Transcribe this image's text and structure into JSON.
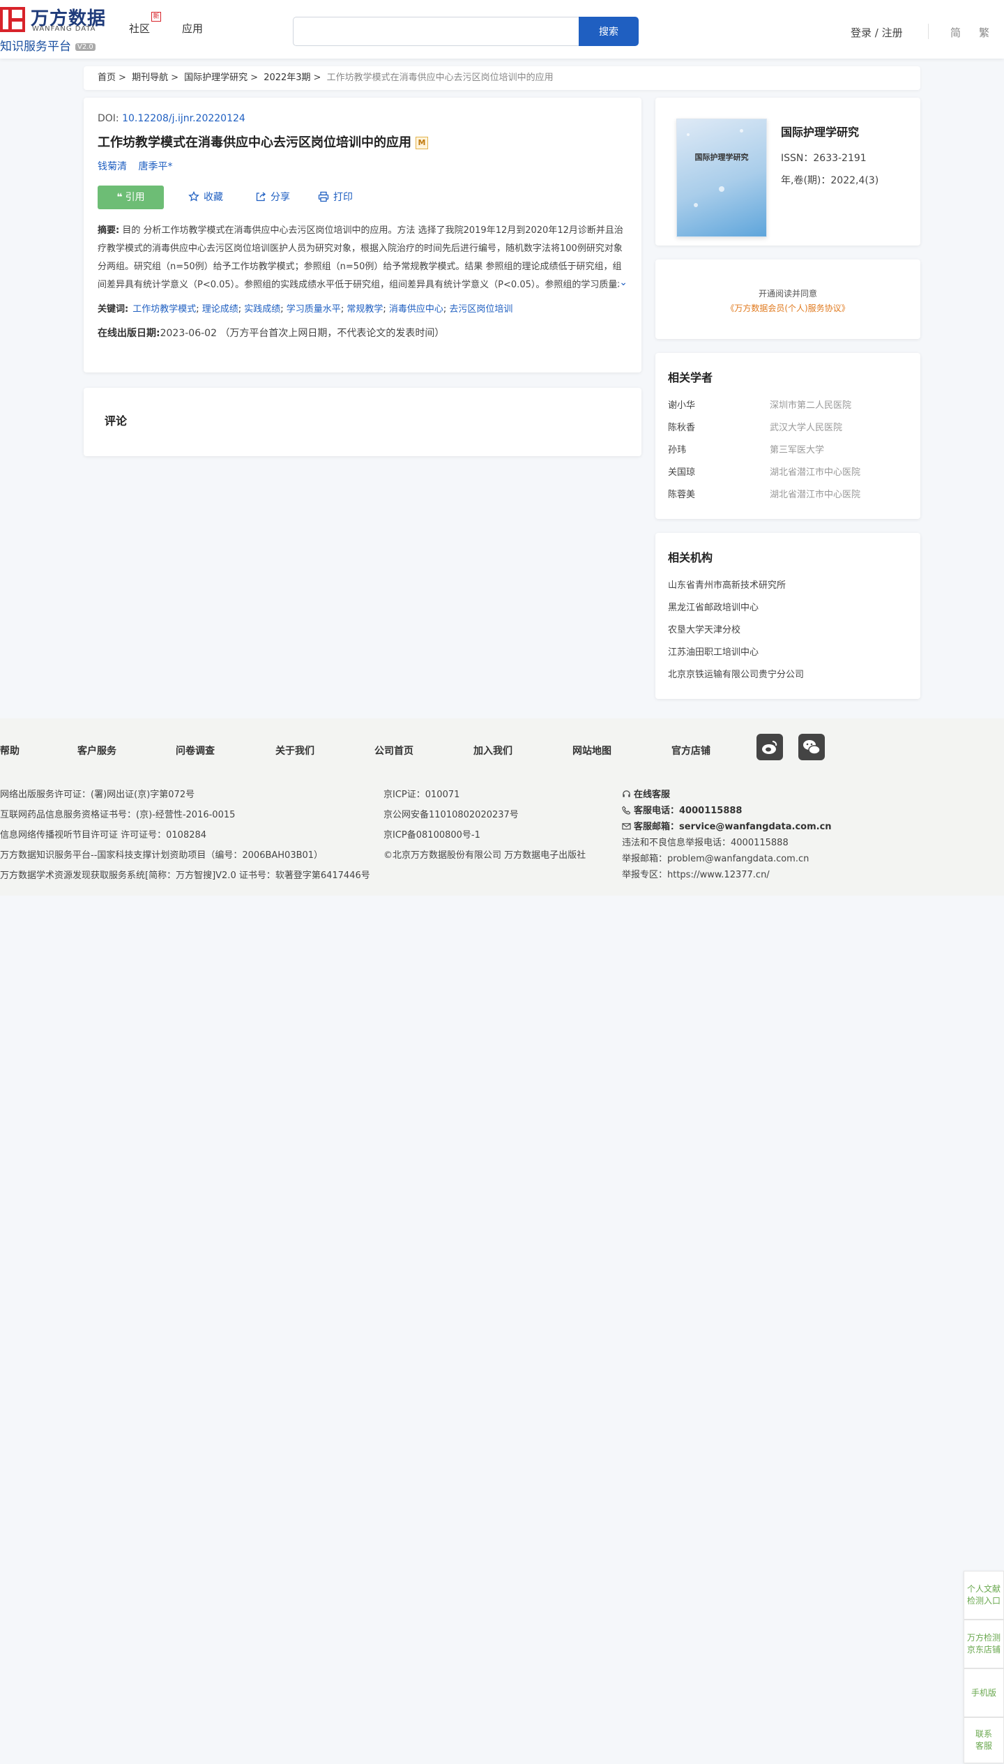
{
  "header": {
    "logo_cn": "万方数据",
    "logo_en": "WANFANG DATA",
    "logo_sub": "知识服务平台",
    "logo_version": "V2.0",
    "nav": [
      {
        "label": "社区",
        "badge": "新"
      },
      {
        "label": "应用"
      }
    ],
    "search_placeholder": "",
    "search_button": "搜索",
    "login": "登录 / 注册",
    "lang_simplified": "简",
    "lang_traditional": "繁"
  },
  "breadcrumb": {
    "items": [
      "首页",
      "期刊导航",
      "国际护理学研究",
      "2022年3期"
    ],
    "current": "工作坊教学模式在消毒供应中心去污区岗位培训中的应用"
  },
  "article": {
    "doi_label": "DOI:",
    "doi": "10.12208/j.ijnr.20220124",
    "title": "工作坊教学模式在消毒供应中心去污区岗位培训中的应用",
    "m_badge": "M",
    "authors": [
      "钱菊清",
      "唐季平*"
    ],
    "actions": {
      "cite": "引用",
      "favorite": "收藏",
      "share": "分享",
      "print": "打印"
    },
    "abstract_label": "摘要:",
    "abstract": "目的 分析工作坊教学模式在消毒供应中心去污区岗位培训中的应用。方法 选择了我院2019年12月到2020年12月诊断并且治疗教学模式的消毒供应中心去污区岗位培训医护人员为研究对象，根据入院治疗的时间先后进行编号，随机数字法将100例研究对象分两组。研究组（n=50例）给予工作坊教学模式；参照组（n=50例）给予常规教学模式。结果 参照组的理论成绩低于研究组，组间差异具有统计学意义（P<0.05）。参照组的实践成绩水平低于研究组，组间差异具有统计学意义（P<0.05）。参照组的学习质量水平低于研究组，组间差异具有统计学意义（P<0.05）。结论 工作坊教学模式在临...",
    "keywords_label": "关键词:",
    "keywords": [
      "工作坊教学模式",
      "理论成绩",
      "实践成绩",
      "学习质量水平",
      "常规教学",
      "消毒供应中心",
      "去污区岗位培训"
    ],
    "pubdate_label": "在线出版日期:",
    "pubdate": "2023-06-02",
    "pubdate_note": "（万方平台首次上网日期，不代表论文的发表时间）"
  },
  "comment": {
    "title": "评论"
  },
  "journal": {
    "cover_title": "国际护理学研究",
    "name": "国际护理学研究",
    "issn": "ISSN：2633-2191",
    "volume": "年,卷(期)：2022,4(3)"
  },
  "membership": {
    "line1": "开通阅读并同意",
    "line2": "《万方数据会员(个人)服务协议》"
  },
  "scholars": {
    "title": "相关学者",
    "items": [
      {
        "name": "谢小华",
        "org": "深圳市第二人民医院"
      },
      {
        "name": "陈秋香",
        "org": "武汉大学人民医院"
      },
      {
        "name": "孙玮",
        "org": "第三军医大学"
      },
      {
        "name": "关国琼",
        "org": "湖北省潜江市中心医院"
      },
      {
        "name": "陈蓉美",
        "org": "湖北省潜江市中心医院"
      }
    ]
  },
  "institutions": {
    "title": "相关机构",
    "items": [
      "山东省青州市高新技术研究所",
      "黑龙江省邮政培训中心",
      "农垦大学天津分校",
      "江苏油田职工培训中心",
      "北京京铁运输有限公司贵宁分公司"
    ]
  },
  "footer": {
    "links": [
      "帮助",
      "客户服务",
      "问卷调查",
      "关于我们",
      "公司首页",
      "加入我们",
      "网站地图",
      "官方店铺"
    ],
    "col1": [
      "网络出版服务许可证：(署)网出证(京)字第072号",
      "互联网药品信息服务资格证书号：(京)-经营性-2016-0015",
      "信息网络传播视听节目许可证 许可证号：0108284",
      "万方数据知识服务平台--国家科技支撑计划资助项目（编号：2006BAH03B01）",
      "万方数据学术资源发现获取服务系统[简称：万方智搜]V2.0 证书号：软著登字第6417446号"
    ],
    "col2": [
      "京ICP证：010071",
      "京公网安备11010802020237号",
      "京ICP备08100800号-1",
      "©北京万方数据股份有限公司 万方数据电子出版社"
    ],
    "service_online": "在线客服",
    "service_phone_label": "客服电话：",
    "service_phone": "4000115888",
    "service_email_label": "客服邮箱：",
    "service_email": "service@wanfangdata.com.cn",
    "report_phone": "违法和不良信息举报电话：4000115888",
    "report_email": "举报邮箱：problem@wanfangdata.com.cn",
    "report_zone": "举报专区：https://www.12377.cn/"
  },
  "side_tools": [
    {
      "line1": "个人文献",
      "line2": "检测入口"
    },
    {
      "line1": "万方检测",
      "line2": "京东店铺"
    },
    {
      "line1": "手机版",
      "line2": ""
    },
    {
      "line1": "联系",
      "line2": "客服"
    }
  ],
  "colors": {
    "brand_blue": "#1f5fc1",
    "brand_red": "#d8232a",
    "cite_green": "#6dbd75",
    "agreement_orange": "#e07a1f"
  }
}
